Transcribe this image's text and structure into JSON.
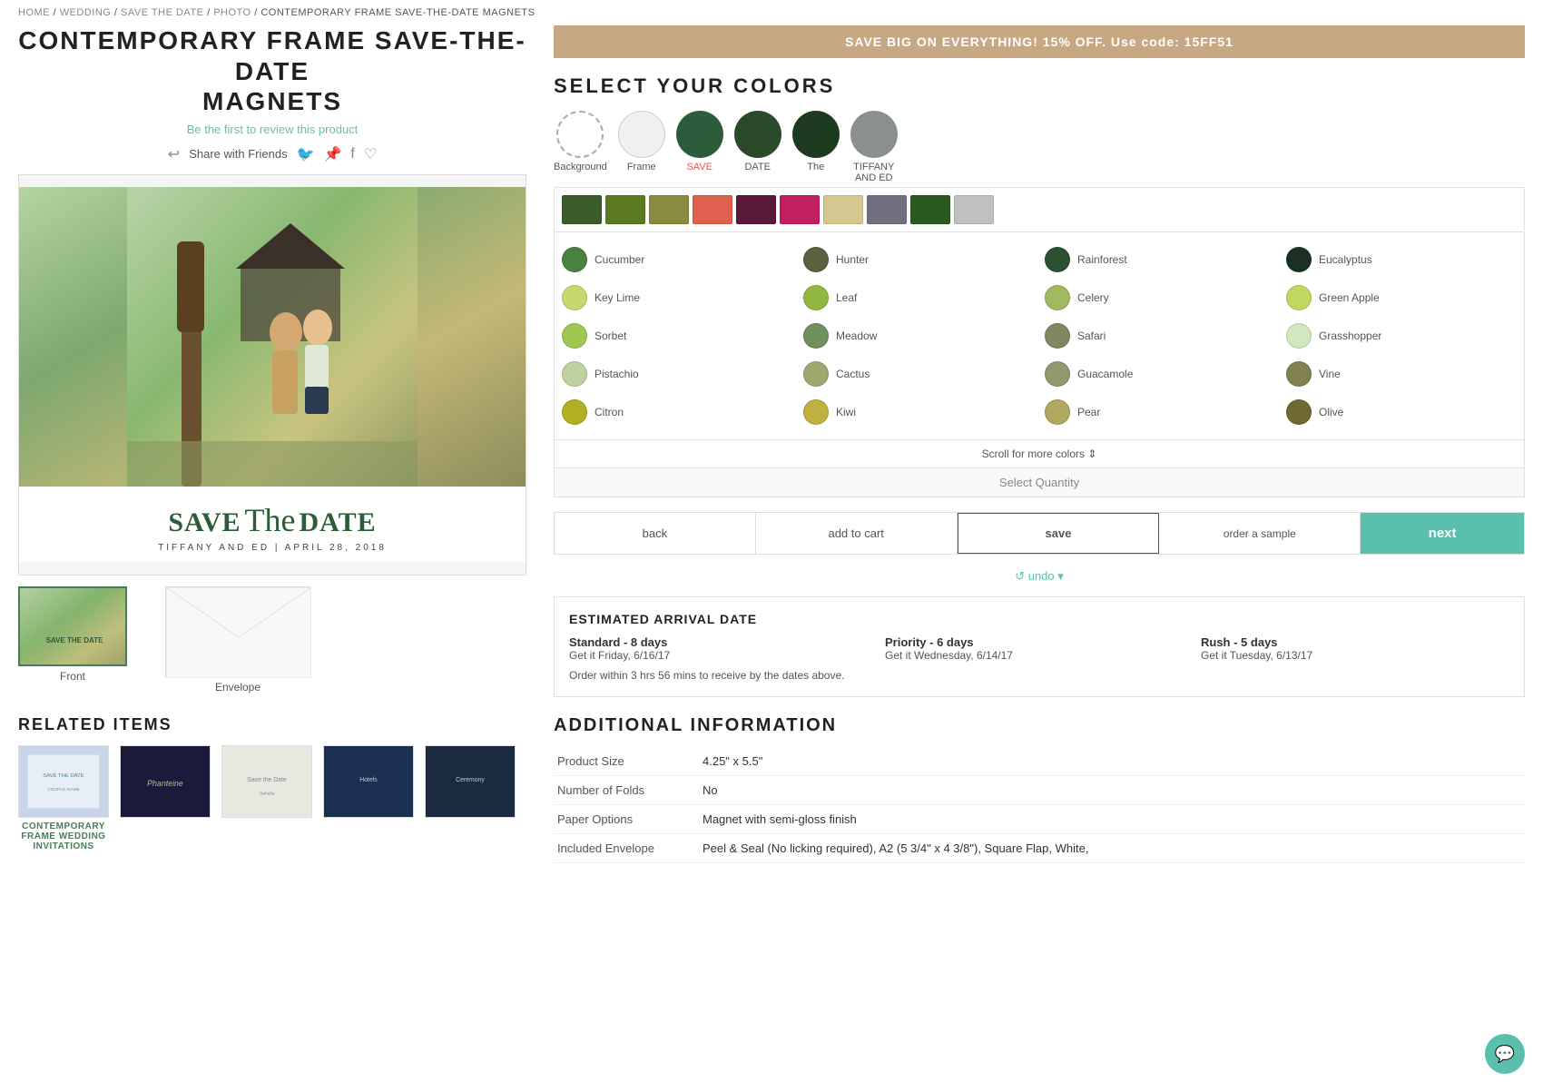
{
  "breadcrumb": {
    "items": [
      {
        "label": "HOME",
        "url": "#"
      },
      {
        "label": "WEDDING",
        "url": "#"
      },
      {
        "label": "SAVE THE DATE",
        "url": "#"
      },
      {
        "label": "PHOTO",
        "url": "#"
      },
      {
        "label": "CONTEMPORARY FRAME SAVE-THE-DATE MAGNETS",
        "url": "#"
      }
    ],
    "separator": "/"
  },
  "product": {
    "title": "CONTEMPORARY FRAME SAVE-THE-DATE\nMAGNETS",
    "title_line1": "CONTEMPORARY FRAME SAVE-THE-DATE",
    "title_line2": "MAGNETS",
    "review_text": "Be the first to review this product",
    "share_label": "Share with Friends",
    "preview": {
      "save_text": "SAVE",
      "the_text": "The",
      "date_text": "DATE",
      "couple_name": "TIFFANY AND ED",
      "date_info": "TIFFANY AND ED  |  APRIL 28, 2018"
    },
    "thumbnails": [
      {
        "label": "Front",
        "type": "front"
      },
      {
        "label": "Envelope",
        "type": "envelope"
      }
    ]
  },
  "related": {
    "section_title": "RELATED ITEMS",
    "items": [
      {
        "name": "CONTEMPORARY FRAME WEDDING INVITATIONS",
        "color_class": "ri-1"
      },
      {
        "name": "",
        "color_class": "ri-2"
      },
      {
        "name": "",
        "color_class": "ri-3"
      },
      {
        "name": "",
        "color_class": "ri-4"
      },
      {
        "name": "",
        "color_class": "ri-5"
      }
    ]
  },
  "promo": {
    "text": "SAVE BIG ON EVERYTHING! 15% OFF. Use code: 15FF51"
  },
  "colors": {
    "section_title": "SELECT YOUR COLORS",
    "selected_swatches": [
      {
        "label": "Background",
        "color": "#ffffff",
        "selected": true,
        "dashed": true
      },
      {
        "label": "Frame",
        "color": "#f0f0f0",
        "selected": false
      },
      {
        "label": "SAVE",
        "color": "#2d5c3a",
        "selected": false,
        "save_label": true
      },
      {
        "label": "DATE",
        "color": "#2a4a2a",
        "selected": false
      },
      {
        "label": "The",
        "color": "#1e3a1e",
        "selected": false
      },
      {
        "label": "TIFFANY\nAND ED",
        "color": "#8a9090",
        "selected": false
      }
    ],
    "palette": [
      {
        "color": "#3a5c2a"
      },
      {
        "color": "#5a7a20"
      },
      {
        "color": "#8a8a40"
      },
      {
        "color": "#e06050"
      },
      {
        "color": "#5a1a3a"
      },
      {
        "color": "#c02060"
      },
      {
        "color": "#d4c890"
      },
      {
        "color": "#707080"
      },
      {
        "color": "#2a5a20"
      },
      {
        "color": "#c0c0c0"
      }
    ],
    "color_options": [
      {
        "name": "Cucumber",
        "color": "#4a8040"
      },
      {
        "name": "Hunter",
        "color": "#5a6040"
      },
      {
        "name": "Rainforest",
        "color": "#2a5030"
      },
      {
        "name": "Eucalyptus",
        "color": "#1a3020"
      },
      {
        "name": "Key Lime",
        "color": "#c8d870"
      },
      {
        "name": "Leaf",
        "color": "#90b840"
      },
      {
        "name": "Celery",
        "color": "#a0b860"
      },
      {
        "name": "Green Apple",
        "color": "#c0d860"
      },
      {
        "name": "Sorbet",
        "color": "#a0c850"
      },
      {
        "name": "Meadow",
        "color": "#709060"
      },
      {
        "name": "Safari",
        "color": "#808860"
      },
      {
        "name": "Grasshopper",
        "color": "#d0e8c0"
      },
      {
        "name": "Pistachio",
        "color": "#c0d0a0"
      },
      {
        "name": "Cactus",
        "color": "#a0a870"
      },
      {
        "name": "Guacamole",
        "color": "#909870"
      },
      {
        "name": "Vine",
        "color": "#808050"
      },
      {
        "name": "Citron",
        "color": "#b0b020"
      },
      {
        "name": "Kiwi",
        "color": "#c0b040"
      },
      {
        "name": "Pear",
        "color": "#b0a860"
      },
      {
        "name": "Olive",
        "color": "#706830"
      }
    ],
    "scroll_more_label": "Scroll for more colors ⇕",
    "select_quantity_label": "Select Quantity"
  },
  "actions": {
    "back_label": "back",
    "add_to_cart_label": "add to cart",
    "save_label": "save",
    "order_sample_label": "order a sample",
    "next_label": "next",
    "undo_label": "↺ undo ▾"
  },
  "arrival": {
    "title": "ESTIMATED ARRIVAL DATE",
    "options": [
      {
        "speed": "Standard - 8 days",
        "date_label": "Get it Friday, 6/16/17"
      },
      {
        "speed": "Priority - 6 days",
        "date_label": "Get it Wednesday, 6/14/17"
      },
      {
        "speed": "Rush - 5 days",
        "date_label": "Get it Tuesday, 6/13/17"
      }
    ],
    "note": "Order within 3 hrs 56 mins to receive by the dates above."
  },
  "additional_info": {
    "title": "ADDITIONAL INFORMATION",
    "rows": [
      {
        "label": "Product Size",
        "value": "4.25\" x 5.5\""
      },
      {
        "label": "Number of Folds",
        "value": "No"
      },
      {
        "label": "Paper Options",
        "value": "Magnet with semi-gloss finish"
      },
      {
        "label": "Included Envelope",
        "value": "Peel & Seal (No licking required), A2 (5 3/4\" x 4 3/8\"), Square Flap, White,"
      }
    ]
  }
}
